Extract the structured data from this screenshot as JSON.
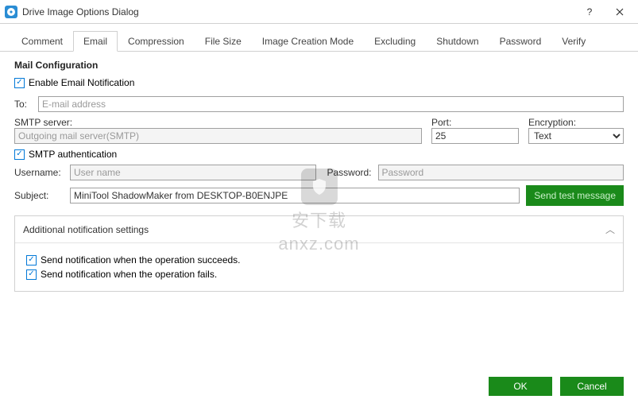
{
  "window": {
    "title": "Drive Image Options Dialog"
  },
  "tabs": {
    "items": [
      "Comment",
      "Email",
      "Compression",
      "File Size",
      "Image Creation Mode",
      "Excluding",
      "Shutdown",
      "Password",
      "Verify"
    ],
    "active_index": 1
  },
  "mail": {
    "section_title": "Mail Configuration",
    "enable_label": "Enable Email Notification",
    "enable_checked": true,
    "to_label": "To:",
    "to_placeholder": "E-mail address",
    "to_value": "",
    "smtp_label": "SMTP server:",
    "smtp_placeholder": "Outgoing mail server(SMTP)",
    "smtp_value": "",
    "port_label": "Port:",
    "port_value": "25",
    "encryption_label": "Encryption:",
    "encryption_value": "Text",
    "smtp_auth_label": "SMTP authentication",
    "smtp_auth_checked": true,
    "username_label": "Username:",
    "username_placeholder": "User name",
    "username_value": "",
    "password_label": "Password:",
    "password_placeholder": "Password",
    "password_value": "",
    "subject_label": "Subject:",
    "subject_value": "MiniTool ShadowMaker from DESKTOP-B0ENJPE",
    "send_test_label": "Send test message"
  },
  "additional": {
    "header": "Additional notification settings",
    "succeed_label": "Send notification when the operation succeeds.",
    "succeed_checked": true,
    "fail_label": "Send notification when the operation fails.",
    "fail_checked": true
  },
  "footer": {
    "ok_label": "OK",
    "cancel_label": "Cancel"
  },
  "watermark": {
    "top": "安下载",
    "bottom": "anxz.com"
  }
}
